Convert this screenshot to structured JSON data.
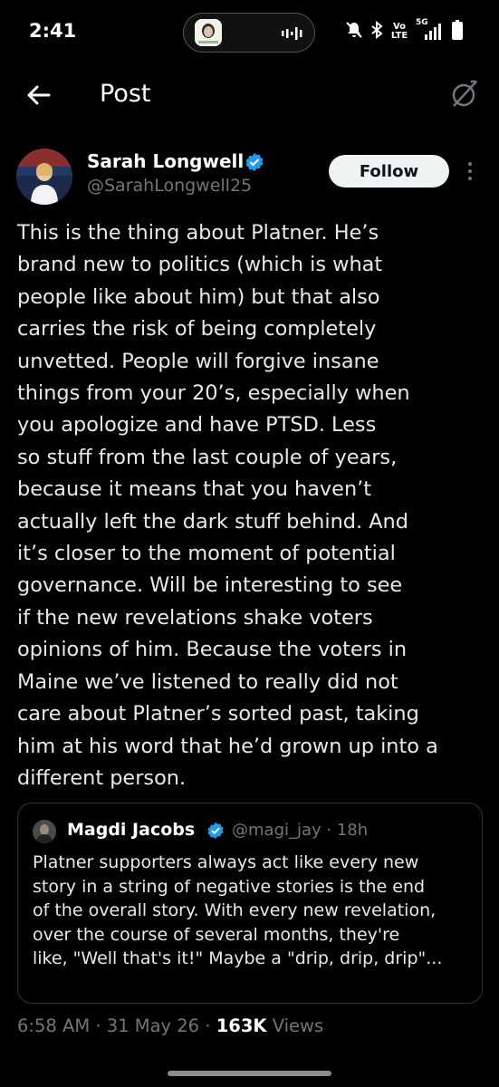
{
  "status_bar": {
    "time": "2:41",
    "network": "5G",
    "volte": "Vo LTE"
  },
  "header": {
    "title": "Post"
  },
  "author": {
    "name": "Sarah Longwell",
    "handle": "@SarahLongwell25",
    "follow_label": "Follow",
    "verified_color": "#1d9bf0"
  },
  "tweet": {
    "lines": [
      "This is the thing about Platner. He’s",
      "brand new to politics (which is what",
      "people like about him) but that also",
      "carries the risk of being completely",
      "unvetted. People will forgive insane",
      "things from your 20’s, especially when",
      "you apologize and have PTSD. Less",
      "so stuff from the last couple of years,",
      "because it means that you haven’t",
      "actually left the dark stuff behind. And",
      "it’s closer to the moment of potential",
      "governance. Will be interesting to see",
      "if the new revelations shake voters",
      "opinions of him. Because the voters in",
      "Maine we’ve listened to really did not",
      "care about Platner’s sorted past, taking",
      "him at his word that he’d grown up into a",
      "different person."
    ]
  },
  "quote": {
    "name": "Magdi Jacobs",
    "handle_time": "@magi_jay · 18h",
    "lines": [
      "Platner supporters always act like every new",
      "story in a string of negative stories is the end",
      "of the overall story. With every new revelation,",
      "over the course of several months, they're",
      "like, \"Well that's it!\" Maybe a \"drip, drip, drip\"..."
    ]
  },
  "meta": {
    "time_date": "6:58 AM · 31 May 26 · ",
    "views_count": "163K",
    "views_label": " Views"
  },
  "colors": {
    "background": "#000000",
    "text": "#e7e9ea",
    "secondary": "#71767b",
    "accent": "#1d9bf0"
  }
}
